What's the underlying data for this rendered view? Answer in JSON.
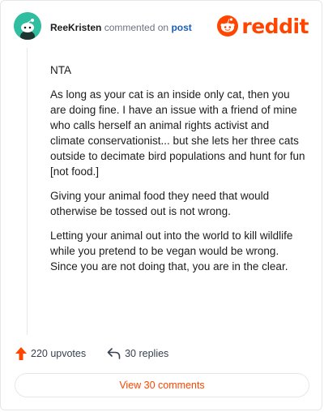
{
  "header": {
    "author": "ReeKristen",
    "action": "commented on",
    "target": "post",
    "brand": "reddit"
  },
  "comment": {
    "paragraphs": [
      "NTA",
      "As long as your cat is an inside only cat, then you are doing fine. I have an issue with a friend of mine who calls herself an animal rights activist and climate conservationist... but she lets her three cats outside to decimate bird populations and hunt for fun [not food.]",
      "Giving your animal food they need that would otherwise be tossed out is not wrong.",
      "Letting your animal out into the world to kill wildlife while you pretend to be vegan would be wrong. Since you are not doing that, you are in the clear."
    ]
  },
  "footer": {
    "upvotes": "220 upvotes",
    "replies": "30 replies",
    "view_label": "View 30 comments"
  },
  "icons": {
    "avatar": "snoo-avatar-icon",
    "logo": "reddit-logo-icon",
    "upvote": "upvote-arrow-icon",
    "reply": "reply-arrow-icon"
  },
  "colors": {
    "accent": "#ff4500",
    "avatar_bg": "#2fbfa0",
    "link": "#1a5fb4"
  }
}
